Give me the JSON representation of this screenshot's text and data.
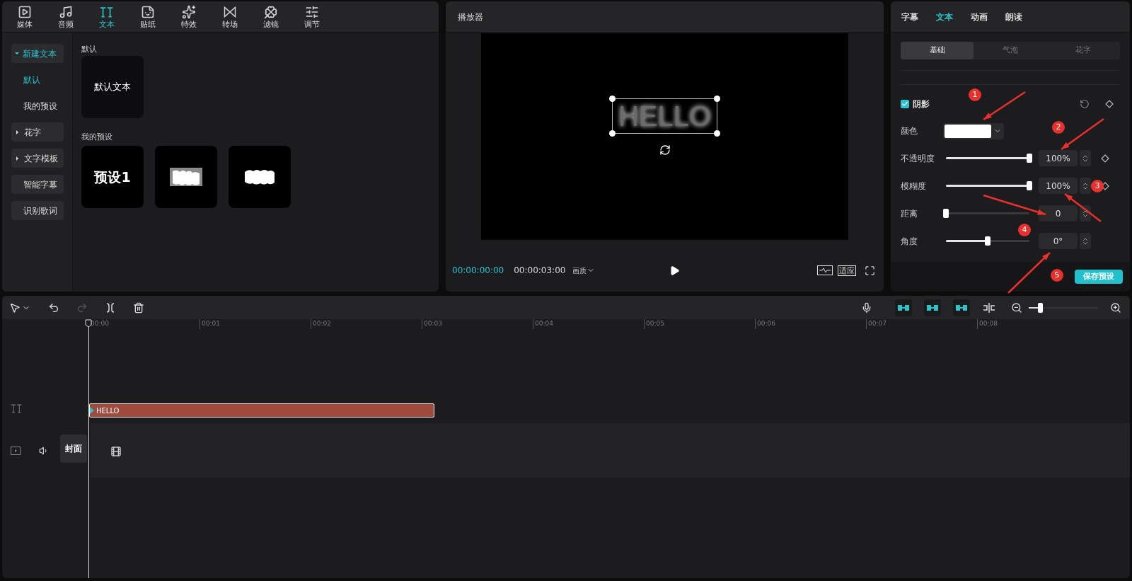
{
  "media_tabs": [
    {
      "label": "媒体",
      "selected": false
    },
    {
      "label": "音频",
      "selected": false
    },
    {
      "label": "文本",
      "selected": true
    },
    {
      "label": "贴纸",
      "selected": false
    },
    {
      "label": "特效",
      "selected": false
    },
    {
      "label": "转场",
      "selected": false
    },
    {
      "label": "滤镜",
      "selected": false
    },
    {
      "label": "调节",
      "selected": false
    }
  ],
  "text_sidebar": [
    {
      "kind": "folder",
      "label": "新建文本",
      "expanded": true,
      "selected": true
    },
    {
      "kind": "item",
      "label": "默认",
      "selected": true
    },
    {
      "kind": "item",
      "label": "我的预设",
      "selected": false
    },
    {
      "kind": "folder",
      "label": "花字",
      "expanded": false,
      "selected": false
    },
    {
      "kind": "folder",
      "label": "文字模板",
      "expanded": false,
      "selected": false
    },
    {
      "kind": "button",
      "label": "智能字幕",
      "selected": false
    },
    {
      "kind": "button",
      "label": "识别歌词",
      "selected": false
    }
  ],
  "default_section": {
    "title": "默认",
    "cards": [
      {
        "kind": "plain",
        "label": "默认文本"
      }
    ]
  },
  "presets_section": {
    "title": "我的预设",
    "cards": [
      {
        "kind": "bold",
        "label": "预设1"
      },
      {
        "kind": "blur-outline"
      },
      {
        "kind": "blur-solid"
      }
    ]
  },
  "player": {
    "title": "播放器",
    "preview_text": "HELLO",
    "current_time": "00:00:00:00",
    "duration": "00:00:03:00",
    "quality": "画质",
    "fit": "适应"
  },
  "inspector": {
    "tabs": [
      {
        "label": "字幕",
        "selected": false
      },
      {
        "label": "文本",
        "selected": true
      },
      {
        "label": "动画",
        "selected": false
      },
      {
        "label": "朗读",
        "selected": false
      }
    ],
    "subtabs": [
      {
        "label": "基础",
        "selected": true
      },
      {
        "label": "气泡",
        "selected": false
      },
      {
        "label": "花字",
        "selected": false
      }
    ],
    "shadow": {
      "label": "阴影",
      "checked": true
    },
    "color": {
      "label": "颜色"
    },
    "sliders": [
      {
        "label": "不透明度",
        "level": 1,
        "reading": "100%",
        "keyframe": true
      },
      {
        "label": "模糊度",
        "level": 1,
        "reading": "100%",
        "keyframe": true
      },
      {
        "label": "距离",
        "level": 0,
        "reading": "0",
        "keyframe": false
      },
      {
        "label": "角度",
        "level": 0.5,
        "reading": "0°",
        "keyframe": false
      }
    ],
    "save_button": "保存预设"
  },
  "annotations": [
    "1",
    "2",
    "3",
    "4",
    "5"
  ],
  "timeline": {
    "ruler": [
      "00:00",
      "00:01",
      "00:02",
      "00:03",
      "00:04",
      "00:05",
      "00:06",
      "00:07",
      "00:08"
    ],
    "text_clip": "HELLO",
    "cover": "封面",
    "zoom": {
      "level": 0.16
    }
  }
}
